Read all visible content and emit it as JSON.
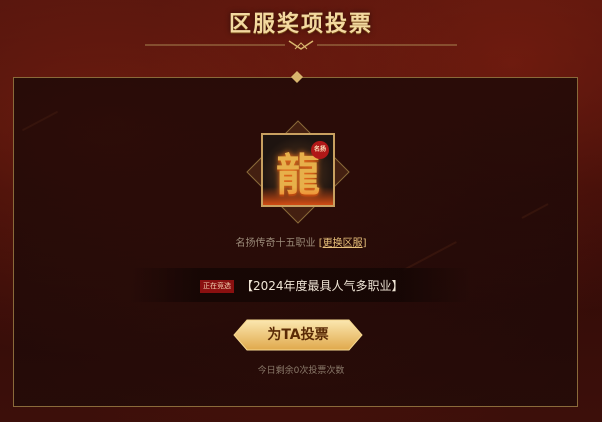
{
  "title": "区服奖项投票",
  "game_icon": {
    "character": "龍",
    "seal_text": "名扬"
  },
  "server": {
    "name": "名扬传奇十五职业",
    "change_bracket_open": "[",
    "change_label": "更换区服",
    "change_bracket_close": "]"
  },
  "nominee": {
    "status_tag": "正在竞选",
    "award": "【2024年度最具人气多职业】"
  },
  "vote_button": {
    "label": "为TA投票"
  },
  "remaining_text": "今日剩余0次投票次数",
  "colors": {
    "gold": "#e7c07a",
    "panel_border": "#8a6a3a",
    "tag_red": "#8a1010"
  }
}
